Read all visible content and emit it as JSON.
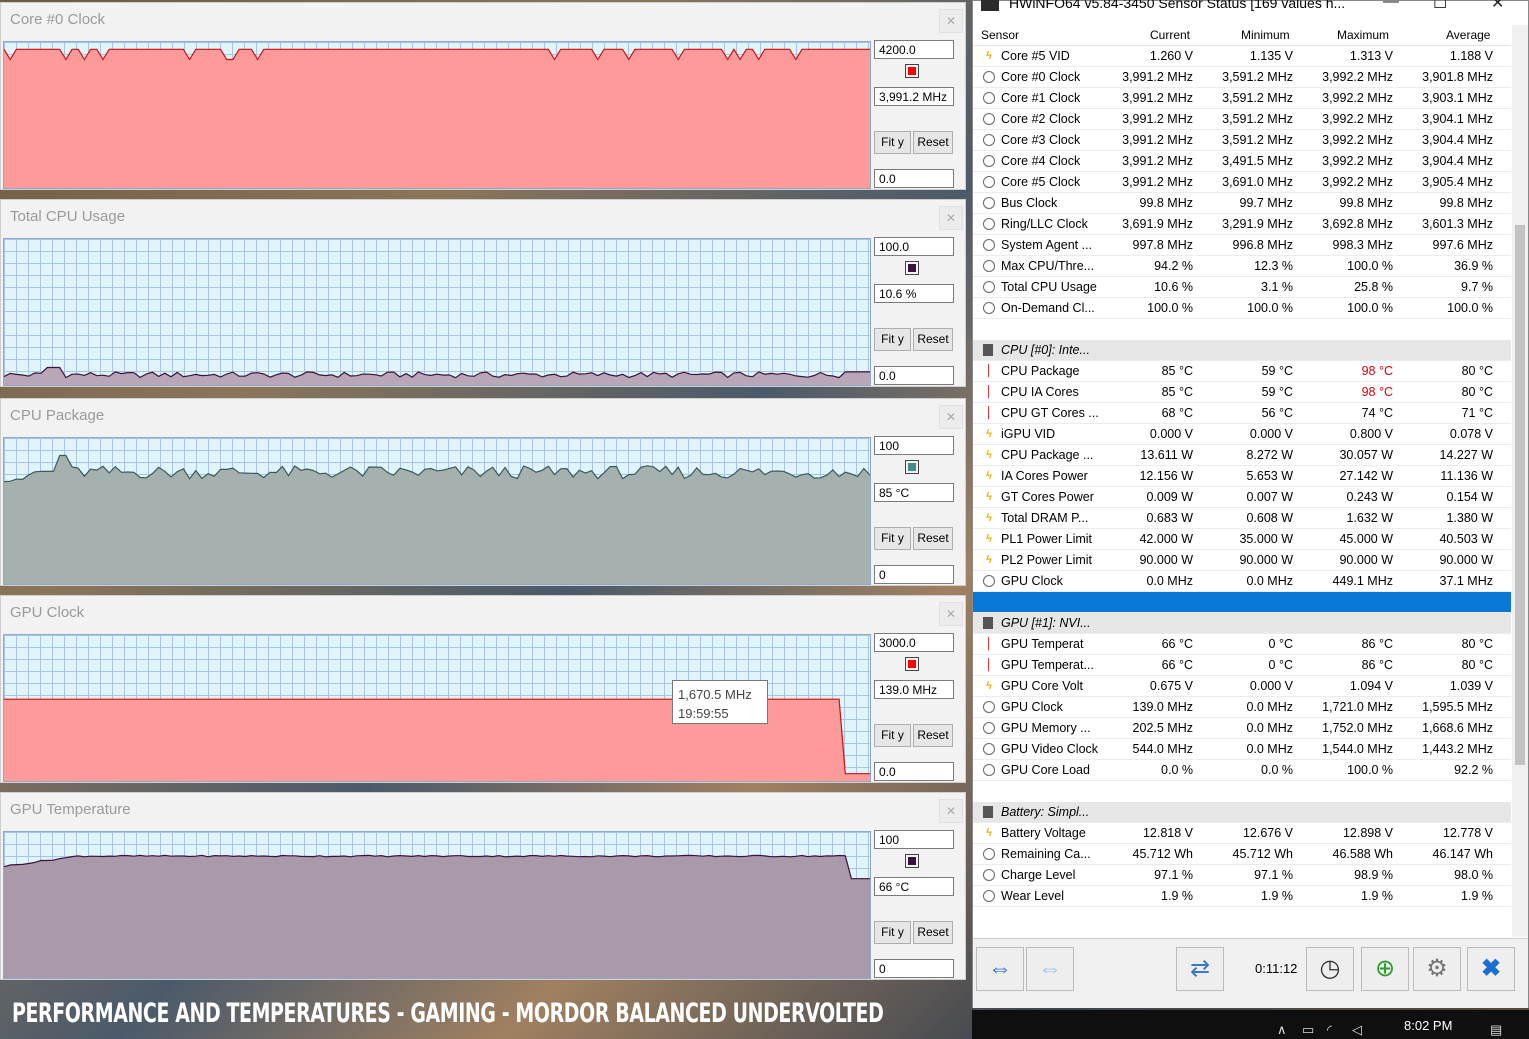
{
  "graphs": [
    {
      "title": "Core #0 Clock",
      "max": "4200.0",
      "current": "3,991.2 MHz",
      "min": "0.0",
      "color": "#ff0000",
      "fill": "#ff9a9a",
      "line": "#cc1010",
      "level": 0.95,
      "kind": "flat-high"
    },
    {
      "title": "Total CPU Usage",
      "max": "100.0",
      "current": "10.6 %",
      "min": "0.0",
      "color": "#3b1140",
      "fill": "#b9a7b7",
      "line": "#3b1140",
      "level": 0.04,
      "kind": "low"
    },
    {
      "title": "CPU Package",
      "max": "100",
      "current": "85 °C",
      "min": "0",
      "color": "#3f8f8f",
      "fill": "#a4b1ae",
      "line": "#3a5a5a",
      "level": 0.8,
      "kind": "noisy"
    },
    {
      "title": "GPU Clock",
      "max": "3000.0",
      "current": "139.0 MHz",
      "min": "0.0",
      "color": "#ff0000",
      "fill": "#ff9a9a",
      "line": "#cc1010",
      "level": 0.56,
      "kind": "drop"
    },
    {
      "title": "GPU Temperature",
      "max": "100",
      "current": "66 °C",
      "min": "0",
      "color": "#3b1140",
      "fill": "#a999aa",
      "line": "#3b1140",
      "level": 0.83,
      "kind": "rise"
    }
  ],
  "buttons": {
    "fit": "Fit y",
    "reset": "Reset"
  },
  "tooltip": {
    "value": "1,670.5 MHz",
    "time": "19:59:55"
  },
  "hwinfo": {
    "title": "HWiNFO64 v5.84-3450 Sensor Status [169 values h...",
    "columns": [
      "Sensor",
      "Current",
      "Minimum",
      "Maximum",
      "Average"
    ],
    "timer": "0:11:12",
    "rows": [
      {
        "t": "bolt",
        "name": "Core #5 VID",
        "v": [
          "1.260 V",
          "1.135 V",
          "1.313 V",
          "1.188 V"
        ]
      },
      {
        "t": "clock",
        "name": "Core #0 Clock",
        "v": [
          "3,991.2 MHz",
          "3,591.2 MHz",
          "3,992.2 MHz",
          "3,901.8 MHz"
        ]
      },
      {
        "t": "clock",
        "name": "Core #1 Clock",
        "v": [
          "3,991.2 MHz",
          "3,591.2 MHz",
          "3,992.2 MHz",
          "3,903.1 MHz"
        ]
      },
      {
        "t": "clock",
        "name": "Core #2 Clock",
        "v": [
          "3,991.2 MHz",
          "3,591.2 MHz",
          "3,992.2 MHz",
          "3,904.1 MHz"
        ]
      },
      {
        "t": "clock",
        "name": "Core #3 Clock",
        "v": [
          "3,991.2 MHz",
          "3,591.2 MHz",
          "3,992.2 MHz",
          "3,904.4 MHz"
        ]
      },
      {
        "t": "clock",
        "name": "Core #4 Clock",
        "v": [
          "3,991.2 MHz",
          "3,491.5 MHz",
          "3,992.2 MHz",
          "3,904.4 MHz"
        ]
      },
      {
        "t": "clock",
        "name": "Core #5 Clock",
        "v": [
          "3,991.2 MHz",
          "3,691.0 MHz",
          "3,992.2 MHz",
          "3,905.4 MHz"
        ]
      },
      {
        "t": "clock",
        "name": "Bus Clock",
        "v": [
          "99.8 MHz",
          "99.7 MHz",
          "99.8 MHz",
          "99.8 MHz"
        ]
      },
      {
        "t": "clock",
        "name": "Ring/LLC Clock",
        "v": [
          "3,691.9 MHz",
          "3,291.9 MHz",
          "3,692.8 MHz",
          "3,601.3 MHz"
        ]
      },
      {
        "t": "clock",
        "name": "System Agent ...",
        "v": [
          "997.8 MHz",
          "996.8 MHz",
          "998.3 MHz",
          "997.6 MHz"
        ]
      },
      {
        "t": "clock",
        "name": "Max CPU/Thre...",
        "v": [
          "94.2 %",
          "12.3 %",
          "100.0 %",
          "36.9 %"
        ]
      },
      {
        "t": "clock",
        "name": "Total CPU Usage",
        "v": [
          "10.6 %",
          "3.1 %",
          "25.8 %",
          "9.7 %"
        ]
      },
      {
        "t": "clock",
        "name": "On-Demand Cl...",
        "v": [
          "100.0 %",
          "100.0 %",
          "100.0 %",
          "100.0 %"
        ]
      },
      {
        "t": "empty",
        "name": "",
        "v": [
          "",
          "",
          "",
          ""
        ]
      },
      {
        "t": "group",
        "name": "CPU [#0]: Inte...",
        "v": [
          "",
          "",
          "",
          ""
        ]
      },
      {
        "t": "therm",
        "name": "CPU Package",
        "v": [
          "85 °C",
          "59 °C",
          "98 °C",
          "80 °C"
        ],
        "redmax": true
      },
      {
        "t": "therm",
        "name": "CPU IA Cores",
        "v": [
          "85 °C",
          "59 °C",
          "98 °C",
          "80 °C"
        ],
        "redmax": true
      },
      {
        "t": "therm",
        "name": "CPU GT Cores ...",
        "v": [
          "68 °C",
          "56 °C",
          "74 °C",
          "71 °C"
        ]
      },
      {
        "t": "bolt",
        "name": "iGPU VID",
        "v": [
          "0.000 V",
          "0.000 V",
          "0.800 V",
          "0.078 V"
        ]
      },
      {
        "t": "bolt",
        "name": "CPU Package ...",
        "v": [
          "13.611 W",
          "8.272 W",
          "30.057 W",
          "14.227 W"
        ]
      },
      {
        "t": "bolt",
        "name": "IA Cores Power",
        "v": [
          "12.156 W",
          "5.653 W",
          "27.142 W",
          "11.136 W"
        ]
      },
      {
        "t": "bolt",
        "name": "GT Cores Power",
        "v": [
          "0.009 W",
          "0.007 W",
          "0.243 W",
          "0.154 W"
        ]
      },
      {
        "t": "bolt",
        "name": "Total DRAM P...",
        "v": [
          "0.683 W",
          "0.608 W",
          "1.632 W",
          "1.380 W"
        ]
      },
      {
        "t": "bolt",
        "name": "PL1 Power Limit",
        "v": [
          "42.000 W",
          "35.000 W",
          "45.000 W",
          "40.503 W"
        ]
      },
      {
        "t": "bolt",
        "name": "PL2 Power Limit",
        "v": [
          "90.000 W",
          "90.000 W",
          "90.000 W",
          "90.000 W"
        ]
      },
      {
        "t": "clock",
        "name": "GPU Clock",
        "v": [
          "0.0 MHz",
          "0.0 MHz",
          "449.1 MHz",
          "37.1 MHz"
        ]
      },
      {
        "t": "sel",
        "name": "",
        "v": [
          "",
          "",
          "",
          ""
        ]
      },
      {
        "t": "group",
        "name": "GPU [#1]: NVI...",
        "v": [
          "",
          "",
          "",
          ""
        ]
      },
      {
        "t": "therm",
        "name": "GPU Temperat",
        "v": [
          "66 °C",
          "0 °C",
          "86 °C",
          "80 °C"
        ]
      },
      {
        "t": "therm",
        "name": "GPU Temperat...",
        "v": [
          "66 °C",
          "0 °C",
          "86 °C",
          "80 °C"
        ]
      },
      {
        "t": "bolt",
        "name": "GPU Core Volt",
        "v": [
          "0.675 V",
          "0.000 V",
          "1.094 V",
          "1.039 V"
        ]
      },
      {
        "t": "clock",
        "name": "GPU Clock",
        "v": [
          "139.0 MHz",
          "0.0 MHz",
          "1,721.0 MHz",
          "1,595.5 MHz"
        ]
      },
      {
        "t": "clock",
        "name": "GPU Memory ...",
        "v": [
          "202.5 MHz",
          "0.0 MHz",
          "1,752.0 MHz",
          "1,668.6 MHz"
        ]
      },
      {
        "t": "clock",
        "name": "GPU Video Clock",
        "v": [
          "544.0 MHz",
          "0.0 MHz",
          "1,544.0 MHz",
          "1,443.2 MHz"
        ]
      },
      {
        "t": "clock",
        "name": "GPU Core Load",
        "v": [
          "0.0 %",
          "0.0 %",
          "100.0 %",
          "92.2 %"
        ]
      },
      {
        "t": "empty",
        "name": "",
        "v": [
          "",
          "",
          "",
          ""
        ]
      },
      {
        "t": "group",
        "name": "Battery: Simpl...",
        "v": [
          "",
          "",
          "",
          ""
        ]
      },
      {
        "t": "bolt",
        "name": "Battery Voltage",
        "v": [
          "12.818 V",
          "12.676 V",
          "12.898 V",
          "12.778 V"
        ]
      },
      {
        "t": "clock",
        "name": "Remaining Ca...",
        "v": [
          "45.712 Wh",
          "45.712 Wh",
          "46.588 Wh",
          "46.147 Wh"
        ]
      },
      {
        "t": "clock",
        "name": "Charge Level",
        "v": [
          "97.1 %",
          "97.1 %",
          "98.9 %",
          "98.0 %"
        ]
      },
      {
        "t": "clock",
        "name": "Wear Level",
        "v": [
          "1.9 %",
          "1.9 %",
          "1.9 %",
          "1.9 %"
        ]
      }
    ]
  },
  "caption": "PERFORMANCE AND TEMPERATURES - GAMING - MORDOR BALANCED UNDERVOLTED",
  "taskbar": {
    "time": "8:02 PM"
  }
}
